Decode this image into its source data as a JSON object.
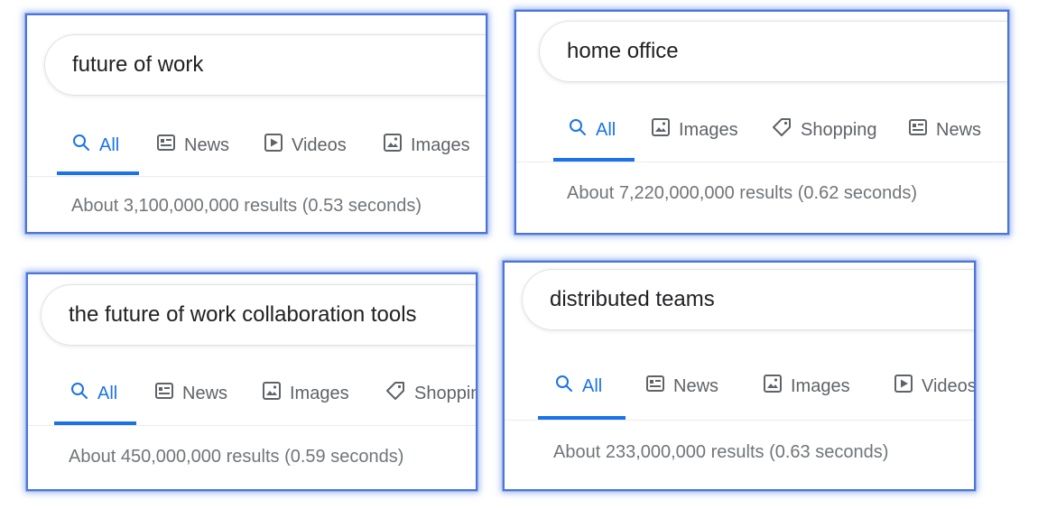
{
  "panels": [
    {
      "query": "future of work",
      "tabs": [
        {
          "label": "All",
          "icon": "search-icon"
        },
        {
          "label": "News",
          "icon": "news-icon"
        },
        {
          "label": "Videos",
          "icon": "video-icon"
        },
        {
          "label": "Images",
          "icon": "image-icon"
        }
      ],
      "result_stats": "About 3,100,000,000 results (0.53 seconds)"
    },
    {
      "query": "home office",
      "tabs": [
        {
          "label": "All",
          "icon": "search-icon"
        },
        {
          "label": "Images",
          "icon": "image-icon"
        },
        {
          "label": "Shopping",
          "icon": "tag-icon"
        },
        {
          "label": "News",
          "icon": "news-icon"
        }
      ],
      "result_stats": "About 7,220,000,000 results (0.62 seconds)"
    },
    {
      "query": "the future of work collaboration tools",
      "tabs": [
        {
          "label": "All",
          "icon": "search-icon"
        },
        {
          "label": "News",
          "icon": "news-icon"
        },
        {
          "label": "Images",
          "icon": "image-icon"
        },
        {
          "label": "Shopping",
          "icon": "tag-icon"
        }
      ],
      "result_stats": "About 450,000,000 results (0.59 seconds)"
    },
    {
      "query": "distributed teams",
      "tabs": [
        {
          "label": "All",
          "icon": "search-icon"
        },
        {
          "label": "News",
          "icon": "news-icon"
        },
        {
          "label": "Images",
          "icon": "image-icon"
        },
        {
          "label": "Videos",
          "icon": "video-icon"
        }
      ],
      "result_stats": "About 233,000,000 results (0.63 seconds)"
    }
  ],
  "colors": {
    "panel_border": "#4a76db",
    "active_tab": "#1a73e8",
    "inactive_tab": "#5f6368",
    "stats_text": "#70757a",
    "query_text": "#202124"
  }
}
